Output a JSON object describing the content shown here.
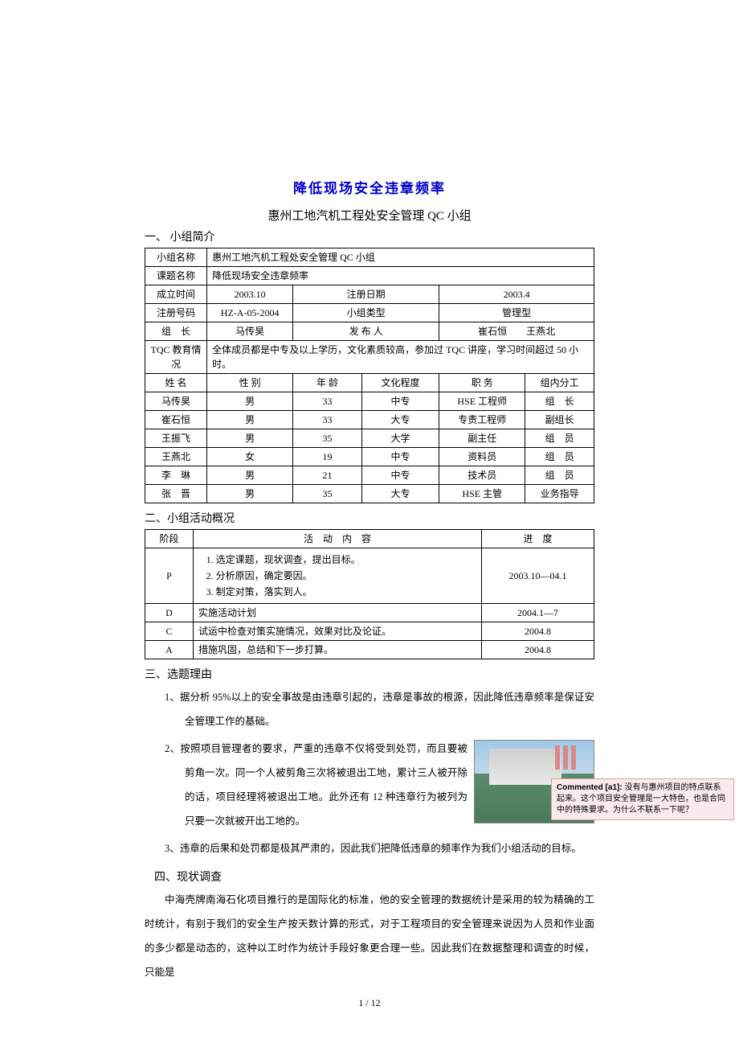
{
  "title1": "降低现场安全违章频率",
  "title2": "惠州工地汽机工程处安全管理 QC 小组",
  "sec1": "一、 小组简介",
  "t1": {
    "r1a": "小组名称",
    "r1b": "惠州工地汽机工程处安全管理 QC 小组",
    "r2a": "课题名称",
    "r2b": "降低现场安全违章频率",
    "r3a": "成立时间",
    "r3b": "2003.10",
    "r3c": "注册日期",
    "r3d": "2003.4",
    "r4a": "注册号码",
    "r4b": "HZ-A-05-2004",
    "r4c": "小组类型",
    "r4d": "管理型",
    "r5a": "组　长",
    "r5b": "马传昊",
    "r5c": "发 布 人",
    "r5d": "崔石恒　　王燕北",
    "r6a": "TQC 教育情况",
    "r6b": "全体成员都是中专及以上学历，文化素质较高，参加过 TQC 讲座，学习时间超过 50 小时。",
    "h1": "姓 名",
    "h2": "性 别",
    "h3": "年 龄",
    "h4": "文化程度",
    "h5": "职 务",
    "h6": "组内分工",
    "m1a": "马传昊",
    "m1b": "男",
    "m1c": "33",
    "m1d": "中专",
    "m1e": "HSE 工程师",
    "m1f": "组　长",
    "m2a": "崔石恒",
    "m2b": "男",
    "m2c": "33",
    "m2d": "大专",
    "m2e": "专责工程师",
    "m2f": "副组长",
    "m3a": "王振飞",
    "m3b": "男",
    "m3c": "35",
    "m3d": "大学",
    "m3e": "副主任",
    "m3f": "组　员",
    "m4a": "王燕北",
    "m4b": "女",
    "m4c": "19",
    "m4d": "中专",
    "m4e": "资料员",
    "m4f": "组　员",
    "m5a": "李　琳",
    "m5b": "男",
    "m5c": "21",
    "m5d": "中专",
    "m5e": "技术员",
    "m5f": "组　员",
    "m6a": "张　晋",
    "m6b": "男",
    "m6c": "35",
    "m6d": "大专",
    "m6e": "HSE 主管",
    "m6f": "业务指导"
  },
  "sec2": "二、小组活动概况",
  "t2": {
    "h1": "阶段",
    "h2": "活　动　内　容",
    "h3": "进　度",
    "p": "P",
    "pli1": "选定课题，现状调查，提出目标。",
    "pli2": "分析原因，确定要因。",
    "pli3": "制定对策，落实到人。",
    "pd": "2003.10—04.1",
    "d": "D",
    "db": "实施活动计划",
    "dd": "2004.1—7",
    "c": "C",
    "cb": "试运中检查对策实施情况，效果对比及论证。",
    "cd": "2004.8",
    "a": "A",
    "ab": "措施巩固，总结和下一步打算。",
    "ad": "2004.8"
  },
  "sec3": "三、选题理由",
  "li1": "1、据分析 95%以上的安全事故是由违章引起的，违章是事故的根源，因此降低违章频率是保证安全管理工作的基础。",
  "li2": "2、按照项目管理者的要求，严重的违章不仅将受到处罚，而且要被剪角一次。同一个人被剪角三次将被退出工地，累计三人被开除的话，项目经理将被退出工地。此外还有 12 种违章行为被列为只要一次就被开出工地的。",
  "li3": "3、违章的后果和处罚都是极其严肃的，因此我们把降低违章的频率作为我们小组活动的目标。",
  "sec4": "四、现状调查",
  "p4": "中海壳牌南海石化项目推行的是国际化的标准，他的安全管理的数据统计是采用的较为精确的工时统计，有别于我们的安全生产按天数计算的形式，对于工程项目的安全管理来说因为人员和作业面的多少都是动态的，这种以工时作为统计手段好象更合理一些。因此我们在数据整理和调查的时候，只能是",
  "pagenum": "1 / 12",
  "comment_label": "Commented [a1]:",
  "comment_text": " 没有与惠州项目的特点联系起来。这个项目安全管理是一大特色，也是合同中的特殊要求。为什么不联系一下呢？"
}
